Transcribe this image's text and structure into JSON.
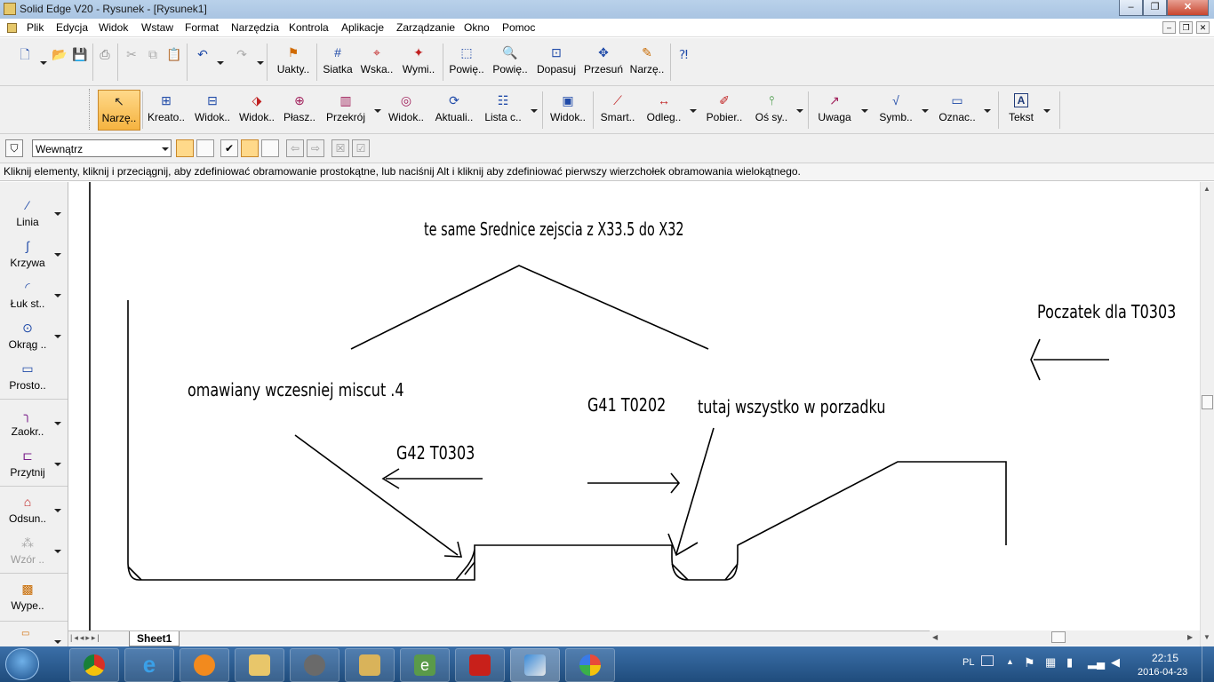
{
  "window": {
    "title": "Solid Edge V20 - Rysunek - [Rysunek1]",
    "controls": {
      "minimize": "–",
      "restore": "❐",
      "close": "✕"
    }
  },
  "menubar": {
    "items": [
      "Plik",
      "Edycja",
      "Widok",
      "Wstaw",
      "Format",
      "Narzędzia",
      "Kontrola",
      "Aplikacje",
      "Zarządzanie",
      "Okno",
      "Pomoc"
    ]
  },
  "toolbar1": {
    "buttons": [
      {
        "label": "Uakty..",
        "icon": "update-icon"
      },
      {
        "label": "Siatka",
        "icon": "grid-icon"
      },
      {
        "label": "Wska..",
        "icon": "pointer-icon"
      },
      {
        "label": "Wymi..",
        "icon": "dimension-icon"
      },
      {
        "label": "Powię..",
        "icon": "zoom-area-icon"
      },
      {
        "label": "Powię..",
        "icon": "zoom-icon"
      },
      {
        "label": "Dopasuj",
        "icon": "fit-icon"
      },
      {
        "label": "Przesuń",
        "icon": "pan-icon"
      },
      {
        "label": "Narzę..",
        "icon": "tools-icon"
      }
    ]
  },
  "toolbar2": {
    "buttons": [
      {
        "label": "Narzę..",
        "icon": "select-tool-icon",
        "active": true
      },
      {
        "label": "Kreato..",
        "icon": "view-wizard-icon"
      },
      {
        "label": "Widok..",
        "icon": "principal-view-icon"
      },
      {
        "label": "Widok..",
        "icon": "auxiliary-view-icon"
      },
      {
        "label": "Płasz..",
        "icon": "cutting-plane-icon"
      },
      {
        "label": "Przekrój",
        "icon": "section-icon"
      },
      {
        "label": "Widok..",
        "icon": "detail-view-icon"
      },
      {
        "label": "Aktuali..",
        "icon": "update-views-icon"
      },
      {
        "label": "Lista c..",
        "icon": "parts-list-icon"
      },
      {
        "label": "Widok..",
        "icon": "drawing-view-icon"
      },
      {
        "label": "Smart..",
        "icon": "smart-dimension-icon"
      },
      {
        "label": "Odleg..",
        "icon": "distance-icon"
      },
      {
        "label": "Pobier..",
        "icon": "retrieve-icon"
      },
      {
        "label": "Oś sy..",
        "icon": "symmetry-axis-icon"
      },
      {
        "label": "Uwaga",
        "icon": "callout-icon"
      },
      {
        "label": "Symb..",
        "icon": "symbol-icon"
      },
      {
        "label": "Oznac..",
        "icon": "mark-icon"
      },
      {
        "label": "Tekst",
        "icon": "text-icon"
      }
    ]
  },
  "ribbon3": {
    "fence_select": "Wewnątrz"
  },
  "prompt": "Kliknij elementy, kliknij i przeciągnij, aby zdefiniować obramowanie prostokątne, lub naciśnij Alt i kliknij aby zdefiniować pierwszy wierzchołek obramowania wielokątnego.",
  "left_tools": [
    {
      "label": "Linia",
      "icon": "line-icon",
      "enabled": true
    },
    {
      "label": "Krzywa",
      "icon": "curve-icon",
      "enabled": true
    },
    {
      "label": "Łuk st..",
      "icon": "arc-icon",
      "enabled": true
    },
    {
      "label": "Okrąg ..",
      "icon": "circle-icon",
      "enabled": true
    },
    {
      "label": "Prosto..",
      "icon": "rectangle-icon",
      "enabled": true
    },
    {
      "label": "Zaokr..",
      "icon": "fillet-icon",
      "enabled": true
    },
    {
      "label": "Przytnij",
      "icon": "trim-icon",
      "enabled": true
    },
    {
      "label": "Odsun..",
      "icon": "offset-icon",
      "enabled": true
    },
    {
      "label": "Wzór ..",
      "icon": "pattern-icon",
      "enabled": false
    },
    {
      "label": "Wype..",
      "icon": "fill-icon",
      "enabled": true
    }
  ],
  "drawing": {
    "notes": {
      "top": "te same Srednice zejscia z X33.5 do X32",
      "start": "Poczatek dla T0303",
      "miscut": "omawiany wczesniej miscut .4",
      "g41": "G41 T0202",
      "ok": "tutaj wszystko w porzadku",
      "g42": "G42 T0303"
    }
  },
  "sheet_tab": "Sheet1",
  "taskbar": {
    "apps": [
      "windows-start-icon",
      "chrome-icon",
      "internet-explorer-icon",
      "media-player-icon",
      "file-explorer-icon",
      "media-center-icon",
      "package-icon",
      "evernote-icon",
      "acrobat-icon",
      "solid-edge-icon",
      "paint-icon"
    ],
    "language": "PL",
    "time": "22:15",
    "date": "2016-04-23"
  }
}
